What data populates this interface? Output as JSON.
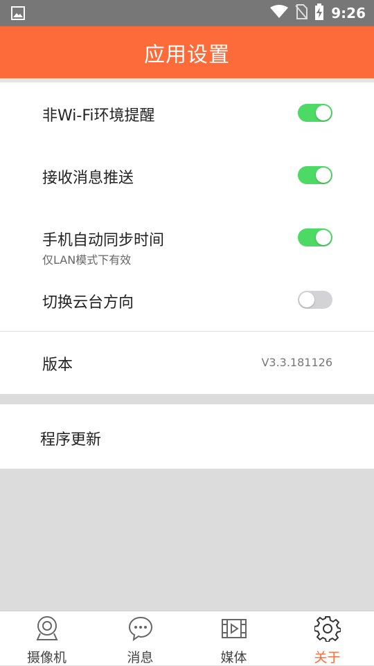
{
  "status_bar": {
    "time": "9:26",
    "icons": [
      "image-icon",
      "wifi-icon",
      "no-sim-icon",
      "battery-charging-icon"
    ]
  },
  "header": {
    "title": "应用设置"
  },
  "settings": [
    {
      "label": "非Wi-Fi环境提醒",
      "toggle": true
    },
    {
      "label": "接收消息推送",
      "toggle": true
    },
    {
      "label": "手机自动同步时间",
      "sublabel": "仅LAN模式下有效",
      "toggle": true
    },
    {
      "label": "切换云台方向",
      "toggle": false
    }
  ],
  "version": {
    "label": "版本",
    "value": "V3.3.181126"
  },
  "update": {
    "label": "程序更新"
  },
  "bottom_nav": {
    "items": [
      {
        "label": "摄像机",
        "icon": "camera-icon"
      },
      {
        "label": "消息",
        "icon": "message-icon"
      },
      {
        "label": "媒体",
        "icon": "film-icon"
      },
      {
        "label": "关于",
        "icon": "gear-icon",
        "active": true
      }
    ]
  },
  "colors": {
    "accent": "#fe6b3a",
    "toggle_on": "#4cd964",
    "toggle_off": "#d3d3d6",
    "status_bar": "#777777"
  }
}
